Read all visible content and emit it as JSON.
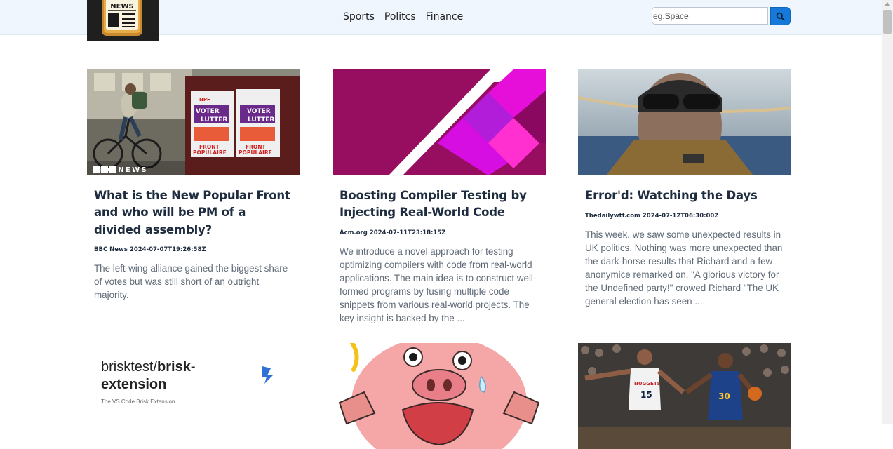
{
  "nav": {
    "links": [
      "Sports",
      "Politcs",
      "Finance"
    ],
    "logo_text": "NEWS"
  },
  "search": {
    "placeholder": "eg.Space",
    "button_icon": "search-icon"
  },
  "colors": {
    "navbar_bg": "#f0f6fd",
    "search_button": "#1479d8",
    "title": "#1e2c3f",
    "description": "#5f6a77"
  },
  "articles": [
    {
      "title": "What is the New Popular Front and who will be PM of a divided assembly?",
      "source": "BBC News",
      "date": "2024-07-07T19:26:58Z",
      "description": "The left-wing alliance gained the biggest share of votes but was still short of an outright majority.",
      "image_labels": {
        "brand": "BBC NEWS",
        "poster_lines": [
          "NPF",
          "VOTER",
          "LUTTER",
          "FRONT",
          "POPULAIRE"
        ]
      }
    },
    {
      "title": "Boosting Compiler Testing by Injecting Real-World Code",
      "source": "Acm.org",
      "date": "2024-07-11T23:18:15Z",
      "description": "We introduce a novel approach for testing optimizing compilers with code from real-world applications. The main idea is to construct well-formed programs by fusing multiple code snippets from various real-world projects. The key insight is backed by the ..."
    },
    {
      "title": "Error'd: Watching the Days",
      "source": "Thedailywtf.com",
      "date": "2024-07-12T06:30:00Z",
      "description": "This week, we saw some unexpected results in UK politics. Nothing was more unexpected than the dark-horse results that Richard and a few anonymice remarked on. \"A glorious victory for the Undefined party!\" crowed Richard \"The UK general election has seen ..."
    },
    {
      "image_labels": {
        "heading_a": "brisktest/",
        "heading_b": "brisk-",
        "heading_c": "extension",
        "subtitle": "The VS Code Brisk Extension"
      }
    },
    {},
    {
      "image_labels": {
        "jersey": "NUGGETS",
        "number": "15",
        "number2": "30"
      }
    }
  ]
}
